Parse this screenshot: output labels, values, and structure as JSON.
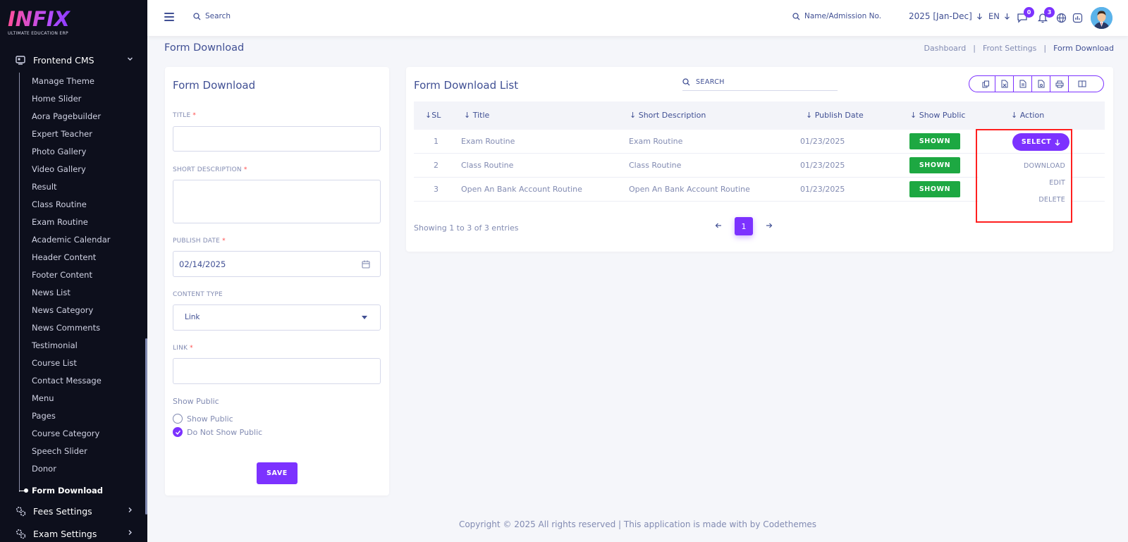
{
  "logo": {
    "text": "INFIX",
    "subtitle": "ULTIMATE EDUCATION ERP"
  },
  "sidebar": {
    "groups": [
      {
        "label": "Frontend CMS",
        "icon": "cms-icon",
        "expanded": true
      },
      {
        "label": "Fees Settings",
        "icon": "gears-icon",
        "expanded": false
      },
      {
        "label": "Exam Settings",
        "icon": "gears-icon",
        "expanded": false
      }
    ],
    "items": [
      {
        "label": "Manage Theme"
      },
      {
        "label": "Home Slider"
      },
      {
        "label": "Aora Pagebuilder"
      },
      {
        "label": "Expert Teacher"
      },
      {
        "label": "Photo Gallery"
      },
      {
        "label": "Video Gallery"
      },
      {
        "label": "Result"
      },
      {
        "label": "Class Routine"
      },
      {
        "label": "Exam Routine"
      },
      {
        "label": "Academic Calendar"
      },
      {
        "label": "Header Content"
      },
      {
        "label": "Footer Content"
      },
      {
        "label": "News List"
      },
      {
        "label": "News Category"
      },
      {
        "label": "News Comments"
      },
      {
        "label": "Testimonial"
      },
      {
        "label": "Course List"
      },
      {
        "label": "Contact Message"
      },
      {
        "label": "Menu"
      },
      {
        "label": "Pages"
      },
      {
        "label": "Course Category"
      },
      {
        "label": "Speech Slider"
      },
      {
        "label": "Donor"
      },
      {
        "label": "Form Download",
        "active": true
      }
    ]
  },
  "topbar": {
    "search_label": "Search",
    "student_search_label": "Name/Admission No.",
    "year": "2025 [Jan-Dec]",
    "language": "EN",
    "messages_count": "0",
    "notifications_count": "3"
  },
  "page": {
    "title": "Form Download",
    "breadcrumb": [
      "Dashboard",
      "Front Settings",
      "Form Download"
    ]
  },
  "form": {
    "title": "Form Download",
    "title_label": "TITLE",
    "short_desc_label": "SHORT DESCRIPTION",
    "publish_date_label": "PUBLISH DATE",
    "publish_date_value": "02/14/2025",
    "content_type_label": "CONTENT TYPE",
    "content_type_value": "Link",
    "link_label": "LINK",
    "required_mark": "*",
    "show_public_label": "Show Public",
    "option_show": "Show Public",
    "option_hide": "Do Not Show Public",
    "selected_option": "Do Not Show Public",
    "save_label": "SAVE"
  },
  "list": {
    "title": "Form Download List",
    "search_placeholder": "SEARCH",
    "columns": [
      "SL",
      "Title",
      "Short Description",
      "Publish Date",
      "Show Public",
      "Action"
    ],
    "rows": [
      {
        "sl": "1",
        "title": "Exam Routine",
        "short_description": "Exam Routine",
        "publish_date": "01/23/2025",
        "show_public": "SHOWN"
      },
      {
        "sl": "2",
        "title": "Class Routine",
        "short_description": "Class Routine",
        "publish_date": "01/23/2025",
        "show_public": "SHOWN"
      },
      {
        "sl": "3",
        "title": "Open An Bank Account Routine",
        "short_description": "Open An Bank Account Routine",
        "publish_date": "01/23/2025",
        "show_public": "SHOWN"
      }
    ],
    "action_button": "SELECT",
    "action_menu": [
      "DOWNLOAD",
      "EDIT",
      "DELETE"
    ],
    "showing_text": "Showing 1 to 3 of 3 entries",
    "current_page": "1"
  },
  "colors": {
    "primary": "#7c32ff",
    "success": "#1da842",
    "highlight": "#ff1f1f",
    "text": "#415094",
    "muted": "#828bb2",
    "sidebar_bg": "#0d0f1c"
  },
  "footer": {
    "text": "Copyright © 2025 All rights reserved | This application is made with by Codethemes"
  }
}
